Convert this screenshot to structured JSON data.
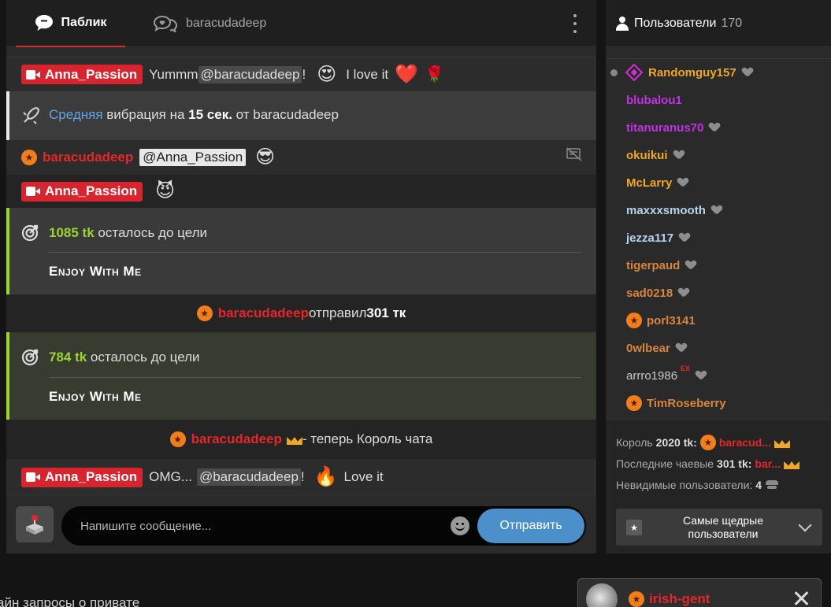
{
  "tabs": {
    "public_label": "Паблик",
    "private_label": "baracudadeep"
  },
  "messages": {
    "m1": {
      "user": "Anna_Passion",
      "text_pre": "Yummm",
      "mention": "@baracudadeep",
      "text_post": "!",
      "emoji1": "😍",
      "text2": "I love it",
      "emoji2": "❤️",
      "emoji3": "🌹"
    },
    "m2": {
      "level": "Средняя",
      "text1": " вибрация на ",
      "duration": "15 сек.",
      "text2": " от baracudadeep"
    },
    "m3": {
      "user": "baracudadeep",
      "mention": "@Anna_Passion",
      "emoji": "😎"
    },
    "m4": {
      "user": "Anna_Passion",
      "emoji": "😈"
    },
    "m5": {
      "amount": "1085 tk",
      "text": " осталось до цели",
      "goal": "Enjoy With Me"
    },
    "m6": {
      "user": "baracudadeep",
      "text": " отправил ",
      "amount": "301 тк"
    },
    "m7": {
      "amount": "784 tk",
      "text": " осталось до цели",
      "goal": "Enjoy With Me"
    },
    "m8": {
      "user": "baracudadeep",
      "text": " - теперь Король чата"
    },
    "m9": {
      "user": "Anna_Passion",
      "text_pre": "OMG...",
      "mention": "@baracudadeep",
      "text_post": "!",
      "emoji": "🔥",
      "text2": "Love it"
    }
  },
  "composer": {
    "placeholder": "Напишите сообщение...",
    "send_label": "Отправить"
  },
  "users": {
    "title": "Пользователи",
    "count": "170",
    "list": [
      {
        "name": "Randomguy157",
        "color": "#f0a824"
      },
      {
        "name": "blubalou1",
        "color": "#c231e5"
      },
      {
        "name": "titanuranus70",
        "color": "#c231e5"
      },
      {
        "name": "okuikui",
        "color": "#f0a824"
      },
      {
        "name": "McLarry",
        "color": "#f0a824"
      },
      {
        "name": "maxxxsmooth",
        "color": "#b9d3ef"
      },
      {
        "name": "jezza117",
        "color": "#b9d3ef"
      },
      {
        "name": "tigerpaud",
        "color": "#d9843f"
      },
      {
        "name": "sad0218",
        "color": "#d9843f"
      },
      {
        "name": "porl3141",
        "color": "#d9843f"
      },
      {
        "name": "0wlbear",
        "color": "#d9843f"
      },
      {
        "name": "arrro1986",
        "color": "#c9c9c9",
        "tag": "EX"
      },
      {
        "name": "TimRoseberry",
        "color": "#d9843f"
      }
    ],
    "king_label": "Король ",
    "king_amount": "2020 tk:",
    "king_user": "baracud...",
    "last_tip_label": "Последние чаевые ",
    "last_tip_amount": "301 tk:",
    "last_tip_user": "bar...",
    "invisible_label": "Невидимые пользователи: ",
    "invisible_count": "4",
    "generous_label": "Самые щедрые пользователи"
  },
  "footer": {
    "requests_text": "айн запросы о привате"
  },
  "toast": {
    "user": "irish-gent"
  }
}
